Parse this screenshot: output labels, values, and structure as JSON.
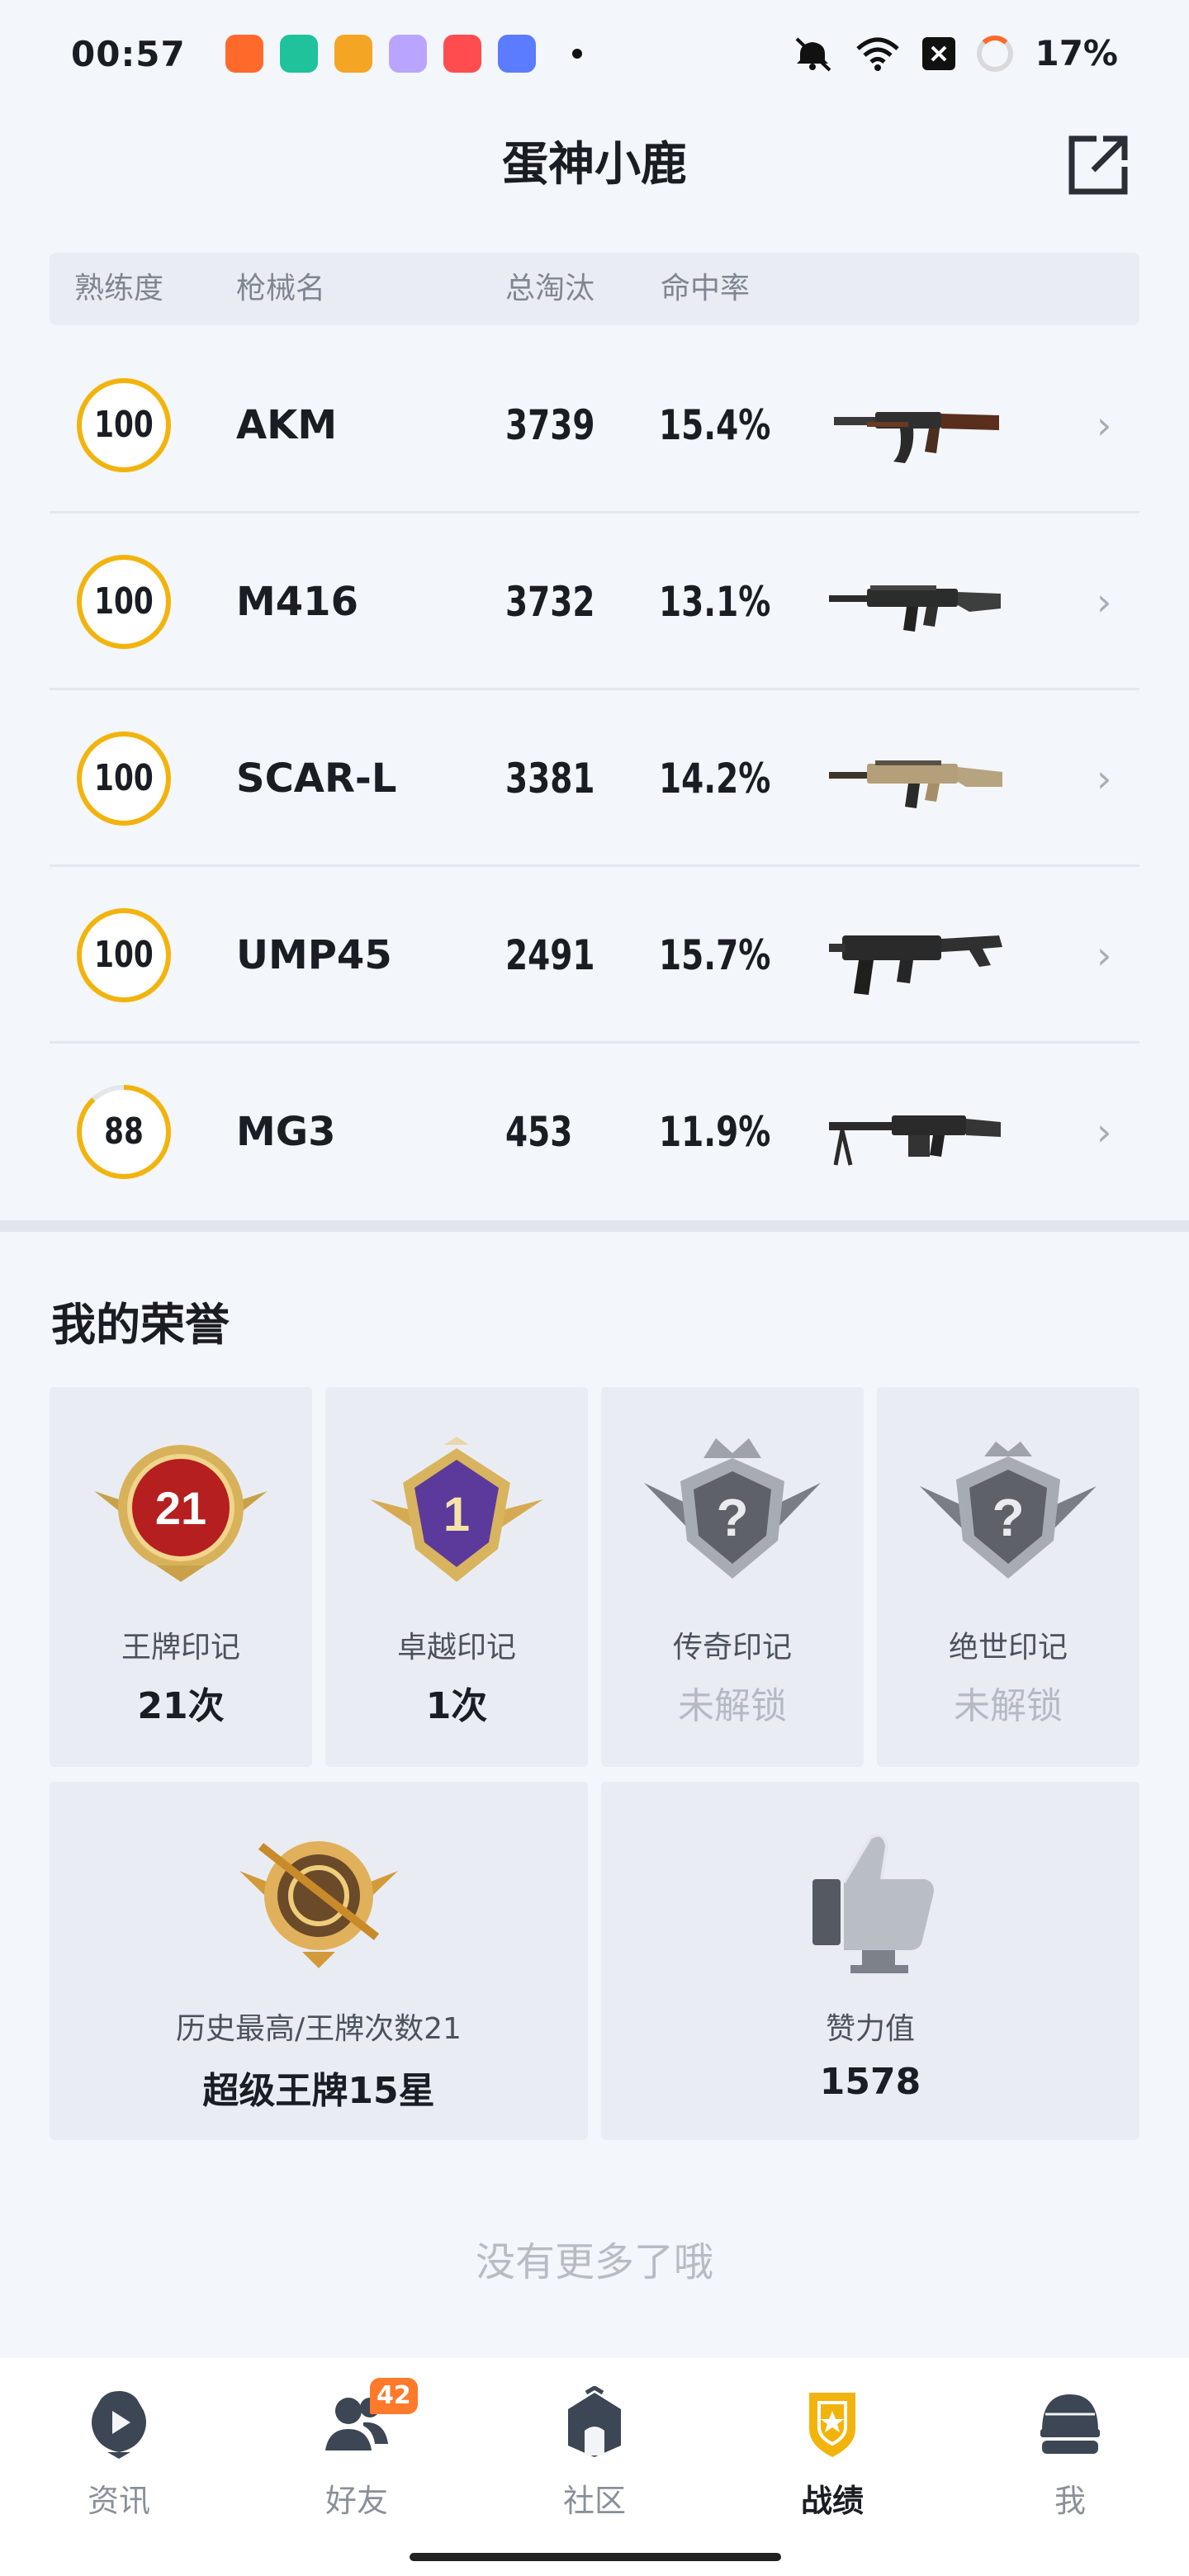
{
  "status_bar": {
    "time": "00:57",
    "battery": "17%",
    "icons": [
      "mute-icon",
      "wifi-icon",
      "close-box-icon",
      "battery-ring-icon"
    ],
    "app_icon_colors": [
      "#ff6a2a",
      "#1fc29a",
      "#f5a524",
      "#b9a4ff",
      "#ff4d4f",
      "#5b7cff"
    ]
  },
  "header": {
    "title": "蛋神小鹿",
    "share_icon": "external-share-icon"
  },
  "table": {
    "headers": {
      "mastery": "熟练度",
      "name": "枪械名",
      "kills": "总淘汰",
      "accuracy": "命中率"
    },
    "rows": [
      {
        "mastery": "100",
        "name": "AKM",
        "kills": "3739",
        "accuracy": "15.4%",
        "weapon_icon": "akm-rifle-icon"
      },
      {
        "mastery": "100",
        "name": "M416",
        "kills": "3732",
        "accuracy": "13.1%",
        "weapon_icon": "m416-rifle-icon"
      },
      {
        "mastery": "100",
        "name": "SCAR-L",
        "kills": "3381",
        "accuracy": "14.2%",
        "weapon_icon": "scar-l-rifle-icon"
      },
      {
        "mastery": "100",
        "name": "UMP45",
        "kills": "2491",
        "accuracy": "15.7%",
        "weapon_icon": "ump45-smg-icon"
      },
      {
        "mastery": "88",
        "name": "MG3",
        "kills": "453",
        "accuracy": "11.9%",
        "weapon_icon": "mg3-lmg-icon"
      }
    ],
    "mastery_ring_color": "#f2b40c"
  },
  "honors": {
    "title": "我的荣誉",
    "marks": [
      {
        "label": "王牌印记",
        "value": "21次",
        "locked": false,
        "badge_number": "21",
        "icon": "ace-mark-badge-icon"
      },
      {
        "label": "卓越印记",
        "value": "1次",
        "locked": false,
        "badge_number": "1",
        "icon": "excellence-mark-badge-icon"
      },
      {
        "label": "传奇印记",
        "value": "未解锁",
        "locked": true,
        "badge_number": "?",
        "icon": "legend-mark-badge-icon"
      },
      {
        "label": "绝世印记",
        "value": "未解锁",
        "locked": true,
        "badge_number": "?",
        "icon": "peerless-mark-badge-icon"
      }
    ],
    "rank": {
      "label": "历史最高/王牌次数21",
      "value": "超级王牌15星",
      "icon": "ace-rank-emblem-icon"
    },
    "likes": {
      "label": "赞力值",
      "value": "1578",
      "icon": "thumbs-up-icon"
    }
  },
  "footer_text": "没有更多了哦",
  "bottom_nav": {
    "items": [
      {
        "label": "资讯",
        "icon": "news-icon",
        "active": false
      },
      {
        "label": "好友",
        "icon": "friends-icon",
        "active": false,
        "badge": "42"
      },
      {
        "label": "社区",
        "icon": "community-icon",
        "active": false
      },
      {
        "label": "战绩",
        "icon": "stats-shield-icon",
        "active": true
      },
      {
        "label": "我",
        "icon": "profile-helmet-icon",
        "active": false
      }
    ],
    "accent_color": "#f2b40c"
  }
}
